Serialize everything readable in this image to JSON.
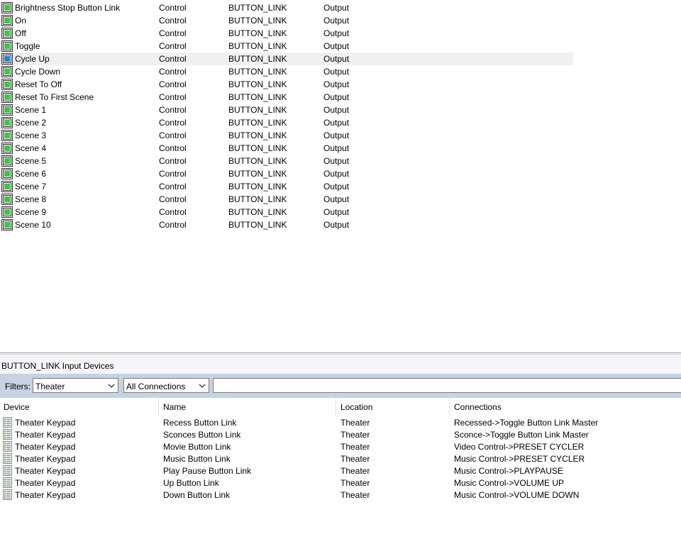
{
  "top_list": {
    "rows": [
      {
        "name": "Brightness Stop Button Link",
        "type": "Control",
        "kind": "BUTTON_LINK",
        "direction": "Output"
      },
      {
        "name": "On",
        "type": "Control",
        "kind": "BUTTON_LINK",
        "direction": "Output"
      },
      {
        "name": "Off",
        "type": "Control",
        "kind": "BUTTON_LINK",
        "direction": "Output"
      },
      {
        "name": "Toggle",
        "type": "Control",
        "kind": "BUTTON_LINK",
        "direction": "Output"
      },
      {
        "name": "Cycle Up",
        "type": "Control",
        "kind": "BUTTON_LINK",
        "direction": "Output",
        "selected": true
      },
      {
        "name": "Cycle Down",
        "type": "Control",
        "kind": "BUTTON_LINK",
        "direction": "Output"
      },
      {
        "name": "Reset To Off",
        "type": "Control",
        "kind": "BUTTON_LINK",
        "direction": "Output"
      },
      {
        "name": "Reset To First Scene",
        "type": "Control",
        "kind": "BUTTON_LINK",
        "direction": "Output"
      },
      {
        "name": "Scene 1",
        "type": "Control",
        "kind": "BUTTON_LINK",
        "direction": "Output"
      },
      {
        "name": "Scene 2",
        "type": "Control",
        "kind": "BUTTON_LINK",
        "direction": "Output"
      },
      {
        "name": "Scene 3",
        "type": "Control",
        "kind": "BUTTON_LINK",
        "direction": "Output"
      },
      {
        "name": "Scene 4",
        "type": "Control",
        "kind": "BUTTON_LINK",
        "direction": "Output"
      },
      {
        "name": "Scene 5",
        "type": "Control",
        "kind": "BUTTON_LINK",
        "direction": "Output"
      },
      {
        "name": "Scene 6",
        "type": "Control",
        "kind": "BUTTON_LINK",
        "direction": "Output"
      },
      {
        "name": "Scene 7",
        "type": "Control",
        "kind": "BUTTON_LINK",
        "direction": "Output"
      },
      {
        "name": "Scene 8",
        "type": "Control",
        "kind": "BUTTON_LINK",
        "direction": "Output"
      },
      {
        "name": "Scene 9",
        "type": "Control",
        "kind": "BUTTON_LINK",
        "direction": "Output"
      },
      {
        "name": "Scene 10",
        "type": "Control",
        "kind": "BUTTON_LINK",
        "direction": "Output"
      }
    ]
  },
  "panel": {
    "title": "BUTTON_LINK Input Devices",
    "filters_label": "Filters:",
    "location_filter": "Theater",
    "connection_filter": "All Connections",
    "search_value": "",
    "columns": [
      "Device",
      "Name",
      "Location",
      "Connections"
    ],
    "rows": [
      {
        "device": "Theater Keypad",
        "name": "Recess Button Link",
        "location": "Theater",
        "connections": "Recessed->Toggle Button Link Master"
      },
      {
        "device": "Theater Keypad",
        "name": "Sconces Button Link",
        "location": "Theater",
        "connections": "Sconce->Toggle Button Link Master"
      },
      {
        "device": "Theater Keypad",
        "name": "Movie Button Link",
        "location": "Theater",
        "connections": "Video Control->PRESET CYCLER"
      },
      {
        "device": "Theater Keypad",
        "name": "Music Button Link",
        "location": "Theater",
        "connections": "Music Control->PRESET CYCLER"
      },
      {
        "device": "Theater Keypad",
        "name": "Play Pause Button Link",
        "location": "Theater",
        "connections": "Music Control->PLAYPAUSE"
      },
      {
        "device": "Theater Keypad",
        "name": "Up Button Link",
        "location": "Theater",
        "connections": "Music Control->VOLUME UP"
      },
      {
        "device": "Theater Keypad",
        "name": "Down Button Link",
        "location": "Theater",
        "connections": "Music Control->VOLUME DOWN"
      }
    ]
  },
  "icons": {
    "button_link_icon": "button-link-icon",
    "keypad_icon": "keypad-icon",
    "dropdown_icon": "chevron-down-icon"
  },
  "colors": {
    "icon_green": "#41c24a",
    "icon_blue": "#2f7bd1",
    "filter_bar": "#c5d3e3"
  }
}
